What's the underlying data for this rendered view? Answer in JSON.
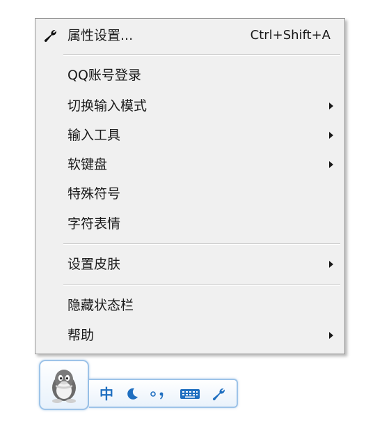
{
  "menu": {
    "items": [
      {
        "label": "属性设置...",
        "shortcut": "Ctrl+Shift+A",
        "icon": "wrench-icon"
      },
      {
        "label": "QQ账号登录"
      },
      {
        "label": "切换输入模式",
        "submenu": true
      },
      {
        "label": "输入工具",
        "submenu": true
      },
      {
        "label": "软键盘",
        "submenu": true
      },
      {
        "label": "特殊符号"
      },
      {
        "label": "字符表情"
      },
      {
        "label": "设置皮肤",
        "submenu": true
      },
      {
        "label": "隐藏状态栏"
      },
      {
        "label": "帮助",
        "submenu": true
      }
    ]
  },
  "status_bar": {
    "avatar_icon": "qq-penguin-icon",
    "mode_label": "中",
    "icons": [
      "moon-icon",
      "punctuation-icon",
      "keyboard-icon",
      "wrench-icon"
    ],
    "accent_color": "#1f6fc0",
    "border_color": "#9dc3e8"
  }
}
